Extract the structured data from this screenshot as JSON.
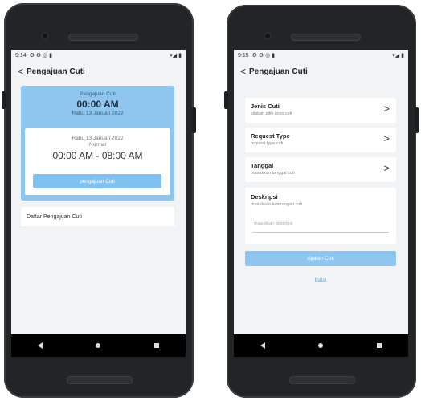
{
  "left_screen": {
    "statusbar": {
      "time": "9:14",
      "icons": "⚙ ⚙ ◎ ▮",
      "right_icons": "▾◢ ▮"
    },
    "appbar": {
      "back_glyph": "<",
      "title": "Pengajuan Cuti"
    },
    "summary": {
      "subtitle": "Pengajuan Cuti",
      "time": "00:00 AM",
      "date": "Rabu 13 Januari 2022"
    },
    "detail": {
      "date": "Rabu 13 Januari 2022",
      "status": "Normal",
      "range": "00:00 AM - 08:00 AM",
      "button_label": "pengajuan Cuti"
    },
    "list_link": "Daftar Pengajuan Cuti"
  },
  "right_screen": {
    "statusbar": {
      "time": "9:15",
      "icons": "⚙ ⚙ ◎ ▮",
      "right_icons": "▾◢ ▮"
    },
    "appbar": {
      "back_glyph": "<",
      "title": "Pengajuan Cuti"
    },
    "fields": [
      {
        "label": "Jenis Cuti",
        "hint": "silakan pilih jenis cuti",
        "chevron": ">"
      },
      {
        "label": "Request Type",
        "hint": "request type cuti",
        "chevron": ">"
      },
      {
        "label": "Tanggal",
        "hint": "masukkan tanggal cuti",
        "chevron": ">"
      }
    ],
    "description": {
      "label": "Deskripsi",
      "hint": "masukkan keterangan cuti",
      "placeholder": "masukkan deskripsi"
    },
    "submit_label": "Ajukan Cuti",
    "cancel_label": "Batal"
  },
  "icons": {
    "left": [
      "back-arrow-icon",
      "chevron-right-icon",
      "nav-back-icon",
      "nav-home-icon",
      "nav-recent-icon"
    ]
  },
  "colors": {
    "accent": "#8ec6ef",
    "phone_body": "#232426",
    "screen_bg": "#f2f3f5"
  }
}
